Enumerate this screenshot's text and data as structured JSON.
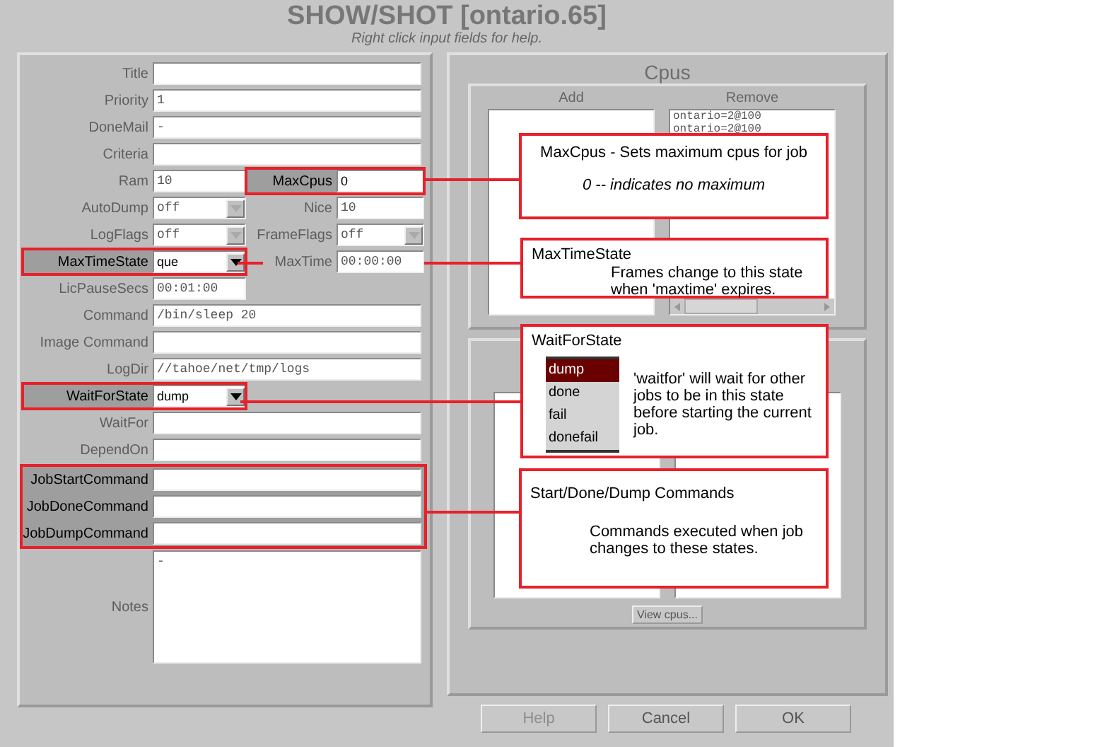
{
  "window": {
    "title": "SHOW/SHOT [ontario.65]",
    "subtitle": "Right click input fields for help."
  },
  "form": {
    "rows": [
      {
        "kind": "full",
        "fields": [
          {
            "kind": "text",
            "label": "Title",
            "highlighted": false
          }
        ]
      },
      {
        "kind": "full",
        "fields": [
          {
            "kind": "text",
            "label": "Priority",
            "value": "1",
            "highlighted": false
          }
        ]
      },
      {
        "kind": "full",
        "fields": [
          {
            "kind": "text",
            "label": "DoneMail",
            "value": "-",
            "highlighted": false
          }
        ]
      },
      {
        "kind": "full",
        "fields": [
          {
            "kind": "text",
            "label": "Criteria",
            "highlighted": false
          }
        ]
      },
      {
        "kind": "split",
        "fields": [
          {
            "kind": "text",
            "label": "Ram",
            "value": "10",
            "highlighted": false
          },
          {
            "kind": "text",
            "label": "MaxCpus",
            "value": "0",
            "highlighted": true
          }
        ]
      },
      {
        "kind": "split",
        "fields": [
          {
            "kind": "combo",
            "label": "AutoDump",
            "value": "off",
            "highlighted": false
          },
          {
            "kind": "text",
            "label": "Nice",
            "value": "10",
            "highlighted": false
          }
        ]
      },
      {
        "kind": "split",
        "fields": [
          {
            "kind": "combo",
            "label": "LogFlags",
            "value": "off",
            "highlighted": false
          },
          {
            "kind": "combo",
            "label": "FrameFlags",
            "value": "off",
            "highlighted": false
          }
        ]
      },
      {
        "kind": "split",
        "fields": [
          {
            "kind": "combo",
            "label": "MaxTimeState",
            "value": "que",
            "highlighted": true
          },
          {
            "kind": "text",
            "label": "MaxTime",
            "value": "00:00:00",
            "highlighted": false
          }
        ]
      },
      {
        "kind": "half",
        "fields": [
          {
            "kind": "text",
            "label": "LicPauseSecs",
            "value": "00:01:00",
            "highlighted": false
          }
        ]
      },
      {
        "kind": "full",
        "fields": [
          {
            "kind": "text",
            "label": "Command",
            "value": "/bin/sleep 20",
            "highlighted": false
          }
        ]
      },
      {
        "kind": "full",
        "fields": [
          {
            "kind": "text",
            "label": "Image Command",
            "highlighted": false
          }
        ]
      },
      {
        "kind": "full",
        "fields": [
          {
            "kind": "text",
            "label": "LogDir",
            "value": "//tahoe/net/tmp/logs",
            "highlighted": false
          }
        ]
      },
      {
        "kind": "half",
        "fields": [
          {
            "kind": "combo",
            "label": "WaitForState",
            "value": "dump",
            "highlighted": true
          }
        ]
      },
      {
        "kind": "full",
        "fields": [
          {
            "kind": "text",
            "label": "WaitFor",
            "highlighted": false
          }
        ]
      },
      {
        "kind": "full",
        "fields": [
          {
            "kind": "text",
            "label": "DependOn",
            "highlighted": false
          }
        ]
      },
      {
        "kind": "group",
        "highlighted": true,
        "rows": [
          {
            "fields": [
              {
                "kind": "text",
                "label": "JobStartCommand",
                "highlighted": true
              }
            ]
          },
          {
            "fields": [
              {
                "kind": "text",
                "label": "JobDoneCommand",
                "highlighted": true
              }
            ]
          },
          {
            "fields": [
              {
                "kind": "text",
                "label": "JobDumpCommand",
                "highlighted": true
              }
            ]
          }
        ]
      },
      {
        "kind": "full",
        "fields": [
          {
            "kind": "textarea",
            "label": "Notes",
            "value": "-",
            "highlighted": false
          }
        ]
      }
    ]
  },
  "cpus": {
    "title": "Cpus",
    "add": {
      "heading": "Add"
    },
    "remove": {
      "heading": "Remove",
      "items": [
        "ontario=2@100",
        "ontario=2@100"
      ]
    },
    "view_button": "View cpus..."
  },
  "buttons": [
    {
      "label": "Help",
      "disabled": true
    },
    {
      "label": "Cancel",
      "disabled": false
    },
    {
      "label": "OK",
      "disabled": false
    }
  ],
  "callouts": [
    {
      "kind": "plain",
      "title": "MaxCpus - Sets maximum cpus for job",
      "note": "0  -- indicates no maximum"
    },
    {
      "kind": "indented",
      "title": "MaxTimeState",
      "text": "Frames change to this state when 'maxtime' expires."
    },
    {
      "kind": "list",
      "title": "WaitForState",
      "options": [
        {
          "label": "dump",
          "selected": true
        },
        {
          "label": "done",
          "selected": false
        },
        {
          "label": "fail",
          "selected": false
        },
        {
          "label": "donefail",
          "selected": false
        }
      ],
      "text": "'waitfor' will wait for other jobs to be in this state before starting the current job."
    },
    {
      "kind": "indented",
      "title": "Start/Done/Dump Commands",
      "text": "Commands executed when job changes to these states."
    }
  ]
}
